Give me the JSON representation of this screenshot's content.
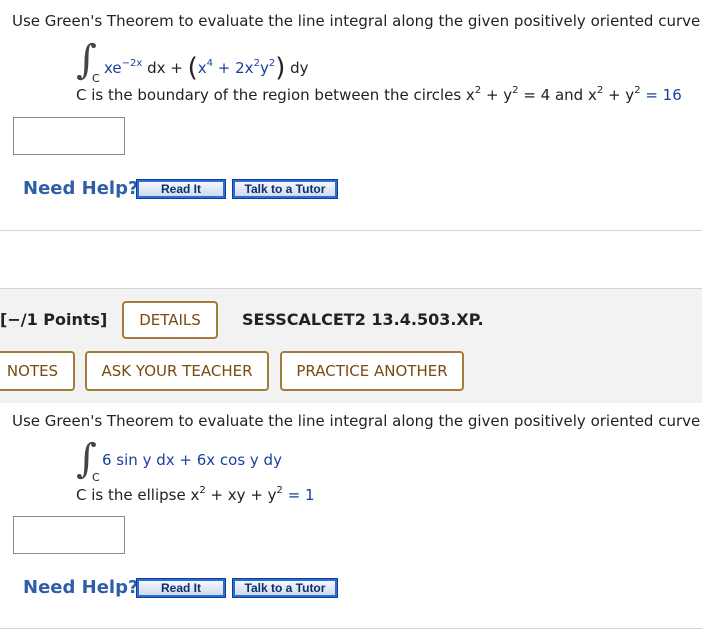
{
  "q1": {
    "instruction": "Use Green's Theorem to evaluate the line integral along the given positively oriented curve.",
    "integral_sub": "C",
    "term1": "xe",
    "term1_exp": "−2x",
    "term1_dx": " dx + ",
    "paren_open": "(",
    "x4": "x",
    "x4_exp": "4",
    "plus": " + 2x",
    "y_exp1": "2",
    "y": "y",
    "y_exp2": "2",
    "paren_close": ")",
    "dy": " dy",
    "boundary": "C is the boundary of the region between the circles x",
    "b_exp1": "2",
    "b_mid1": " + y",
    "b_exp2": "2",
    "b_mid2": " = 4 and x",
    "b_exp3": "2",
    "b_mid3": " + y",
    "b_exp4": "2",
    "b_end": " = 16",
    "need_help": "Need Help?",
    "read_it": "Read It",
    "talk_tutor": "Talk to a Tutor"
  },
  "q2": {
    "points": "[−/1 Points]",
    "details": "DETAILS",
    "code": "SESSCALCET2 13.4.503.XP.",
    "notes": "NOTES",
    "ask_teacher": "ASK YOUR TEACHER",
    "practice": "PRACTICE ANOTHER",
    "instruction": "Use Green's Theorem to evaluate the line integral along the given positively oriented curve.",
    "integral_sub": "C",
    "integrand": "6 sin y dx + 6x cos y dy",
    "curve": "C is the ellipse x",
    "c_exp1": "2",
    "c_mid": " + xy + y",
    "c_exp2": "2",
    "c_end": " = 1",
    "need_help": "Need Help?",
    "read_it": "Read It",
    "talk_tutor": "Talk to a Tutor"
  }
}
